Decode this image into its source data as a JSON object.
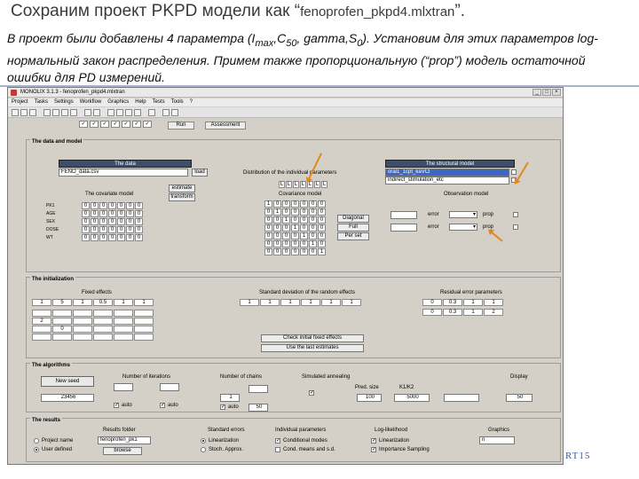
{
  "slide": {
    "title_main": "Сохраним проект PKPD модели как “",
    "title_file": "fenoprofen_pkpd4.mlxtran",
    "title_end": "”.",
    "desc_a": "В проект были добавлены 4 параметра (I",
    "desc_sub_max": "max",
    "desc_b": ",C",
    "desc_sub_50": "50",
    "desc_c": ", gamma,S",
    "desc_sub_0": "0",
    "desc_d": "). Установим для этих параметров log-нормальный закон распределения. Примем также пропорциональную (“prop”) модель остаточной ошибки для PD измерений.",
    "footer": "RT15"
  },
  "window": {
    "title": "MONOLIX 3.1.3 - fenoprofen_pkpd4.mlxtran",
    "menu": [
      "Project",
      "Tasks",
      "Settings",
      "Workflow",
      "Graphics",
      "Help",
      "Tests",
      "Tools",
      "?"
    ],
    "run_button": "Run",
    "assessment_button": "Assessment"
  },
  "data_model": {
    "section_label": "The data and model",
    "data_header": "The data",
    "data_file": "FENO_data.csv",
    "data_browse": "load",
    "struct_header": "The structural model",
    "struct_items": [
      "oral1_1cpt_kaVCl",
      "indirect_stimulation_etc"
    ],
    "dist_label": "Distribution of the individual parameters",
    "dist_letters": [
      "L",
      "L",
      "L",
      "L",
      "L",
      "L",
      "L"
    ],
    "covariate_header": "The covariate model",
    "estimate_btn": "estimate",
    "transform_btn": "transform",
    "cov_rows": [
      "PK1",
      "AGE",
      "SEX",
      "DOSE",
      "WT"
    ],
    "covariance_header": "Covariance model",
    "diag_btn": "Diagonal",
    "full_btn": "Full",
    "perso_btn": "Per set",
    "obs_header": "Observation model",
    "obs_rows": [
      {
        "err": "error",
        "model": "prop"
      },
      {
        "err": "error",
        "model": "prop"
      }
    ]
  },
  "initialization": {
    "section_label": "The initialization",
    "fixed_label": "Fixed effects",
    "fixed_values": [
      "1",
      "5",
      "1",
      "0.5",
      "1",
      "1"
    ],
    "fixed_extra_a": "2",
    "fixed_extra_b": "0",
    "sd_label": "Standard deviation of the random effects",
    "sd_values": [
      "1",
      "1",
      "1",
      "1",
      "1",
      "1"
    ],
    "res_label": "Residual error parameters",
    "res_values_a": [
      "0",
      "0.3",
      "1",
      "1"
    ],
    "res_values_b": [
      "0",
      "0.3",
      "1",
      "2"
    ],
    "check_btn": "Check initial fixed effects",
    "use_btn": "Use the last estimates"
  },
  "algorithms": {
    "section_label": "The algorithms",
    "new_seed_btn": "New seed",
    "seed_value": "23456",
    "k1_label": "Number of iterations",
    "k1_auto": "auto",
    "k2_auto": "auto",
    "chains_label": "Number of chains",
    "chains_value": "1",
    "chains_auto": "auto",
    "chains_extra": "50",
    "sa_label": "Simulated annealing",
    "pred_label": "Pred. size",
    "pred_value": "100",
    "k12_label": "K1/K2",
    "k12_value": "5000",
    "display_label": "Display",
    "display_value": "50"
  },
  "results": {
    "section_label": "The results",
    "folder_header": "Results folder",
    "folder_value": "fenoprofen_pk1",
    "browse_btn": "browse",
    "opt_project": "Project name",
    "opt_user": "User defined",
    "se_header": "Standard errors",
    "se_lin": "Linearization",
    "se_sa": "Stoch. Approx.",
    "ind_header": "Individual parameters",
    "ind_mode": "Conditional modes",
    "ind_mean": "Cond. means and s.d.",
    "ll_header": "Log-likelihood",
    "ll_lin": "Linearization",
    "ll_is": "Importance Sampling",
    "graphics_header": "Graphics",
    "graphics_value": "n"
  }
}
